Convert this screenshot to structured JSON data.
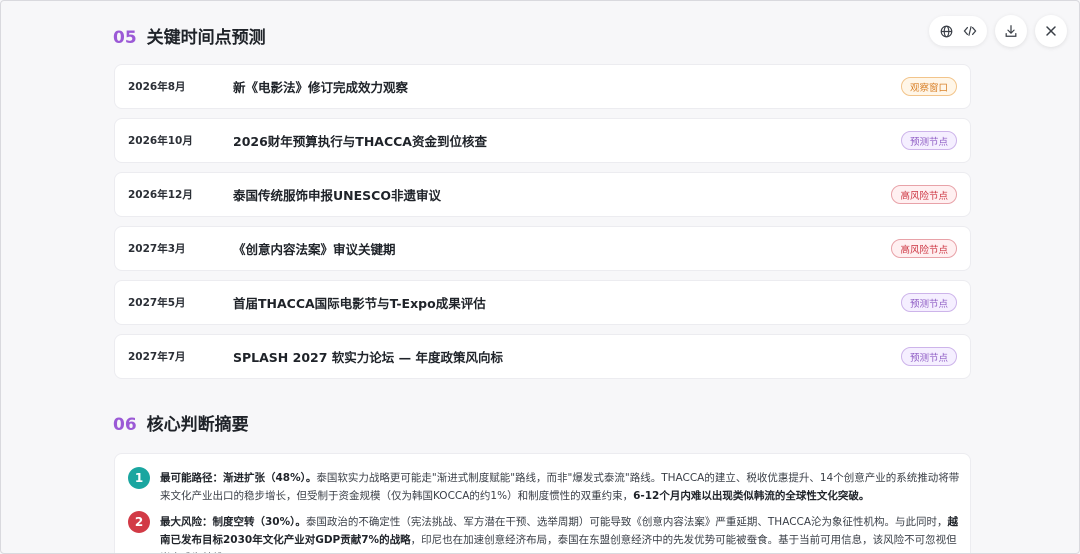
{
  "section5": {
    "number": "05",
    "title": "关键时间点预测",
    "rows": [
      {
        "date": "2026年8月",
        "event": "新《电影法》修订完成效力观察",
        "badge": "观察窗口",
        "badge_type": "observe"
      },
      {
        "date": "2026年10月",
        "event": "2026财年预算执行与THACCA资金到位核查",
        "badge": "预测节点",
        "badge_type": "predict"
      },
      {
        "date": "2026年12月",
        "event": "泰国传统服饰申报UNESCO非遗审议",
        "badge": "高风险节点",
        "badge_type": "risk"
      },
      {
        "date": "2027年3月",
        "event": "《创意内容法案》审议关键期",
        "badge": "高风险节点",
        "badge_type": "risk"
      },
      {
        "date": "2027年5月",
        "event": "首届THACCA国际电影节与T-Expo成果评估",
        "badge": "预测节点",
        "badge_type": "predict"
      },
      {
        "date": "2027年7月",
        "event": "SPLASH 2027 软实力论坛 — 年度政策风向标",
        "badge": "预测节点",
        "badge_type": "predict"
      }
    ]
  },
  "section6": {
    "number": "06",
    "title": "核心判断摘要",
    "items": [
      {
        "index": "1",
        "lead": "最可能路径：渐进扩张（48%）。",
        "body": "泰国软实力战略更可能走\"渐进式制度赋能\"路线，而非\"爆发式泰流\"路线。THACCA的建立、税收优惠提升、14个创意产业的系统推动将带来文化产业出口的稳步增长，但受制于资金规模（仅为韩国KOCCA的约1%）和制度惯性的双重约束，",
        "tail": "6-12个月内难以出现类似韩流的全球性文化突破。"
      },
      {
        "index": "2",
        "lead": "最大风险：制度空转（30%）。",
        "body": "泰国政治的不确定性（宪法挑战、军方潜在干预、选举周期）可能导致《创意内容法案》严重延期、THACCA沦为象征性机构。与此同时，",
        "bold2": "越南已发布目标2030年文化产业对GDP贡献7%的战略",
        "tail": "，印尼也在加速创意经济布局，泰国在东盟创意经济中的先发优势可能被蚕食。基于当前可用信息，该风险不可忽视但尚未成为基线。"
      }
    ]
  },
  "toolbar": {
    "icons": [
      "globe-icon",
      "code-icon",
      "download-icon",
      "close-icon"
    ]
  },
  "colors": {
    "accent_purple": "#9b59d6",
    "teal": "#1aa6a0",
    "red": "#d23a46",
    "observe": "#d9822b",
    "predict": "#8e5cc4",
    "risk": "#cc3340"
  }
}
